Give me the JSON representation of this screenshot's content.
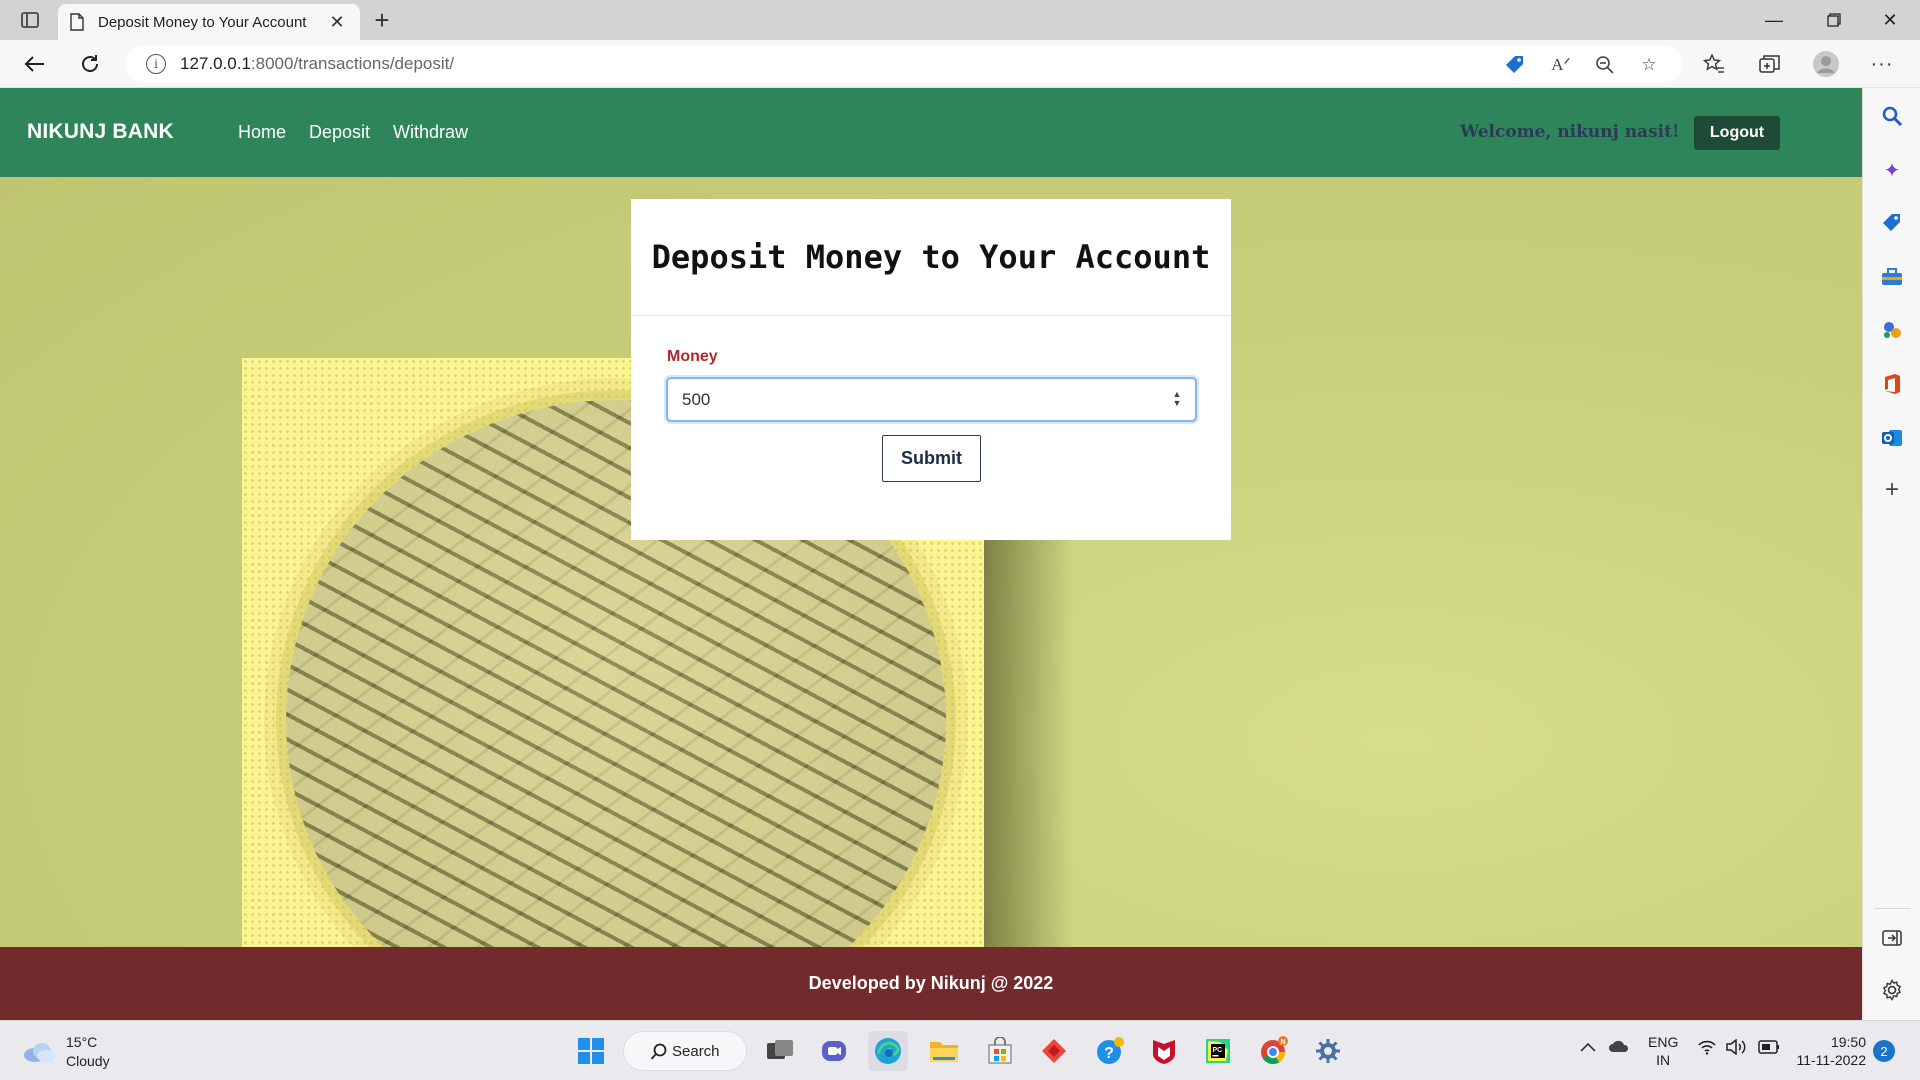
{
  "browser": {
    "tab_title": "Deposit Money to Your Account",
    "url_host": "127.0.0.1",
    "url_path": ":8000/transactions/deposit/",
    "icons": [
      "tab-actions-icon",
      "document-icon",
      "close-icon",
      "new-tab-icon",
      "minimize-icon",
      "restore-icon",
      "window-close-icon",
      "back-icon",
      "refresh-icon",
      "site-info-icon",
      "shopping-tag-icon",
      "read-aloud-icon",
      "zoom-out-icon",
      "add-favorite-icon",
      "favorites-icon",
      "collections-icon",
      "profile-icon",
      "more-icon"
    ]
  },
  "sidebar": {
    "icons": [
      "search-icon",
      "copilot-icon",
      "shopping-icon",
      "tools-icon",
      "games-icon",
      "office-icon",
      "outlook-icon",
      "add-icon",
      "hide-sidebar-icon",
      "settings-icon"
    ]
  },
  "navbar": {
    "brand": "NIKUNJ BANK",
    "links": [
      "Home",
      "Deposit",
      "Withdraw"
    ],
    "welcome": "Welcome, nikunj nasit!",
    "logout": "Logout"
  },
  "form": {
    "title": "Deposit Money to Your Account",
    "money_label": "Money",
    "money_value": "500",
    "submit": "Submit"
  },
  "footer": {
    "text": "Developed by Nikunj @ 2022"
  },
  "taskbar": {
    "temperature": "15°C",
    "condition": "Cloudy",
    "search_label": "Search",
    "language": "ENG",
    "region": "IN",
    "time": "19:50",
    "date": "11-11-2022",
    "notifications": "2"
  },
  "colors": {
    "navbar": "#2e8559",
    "footer": "#732a2c",
    "page_background": "#c5cc79",
    "label_red": "#b0272d",
    "logout_bg": "#1e4b36"
  }
}
